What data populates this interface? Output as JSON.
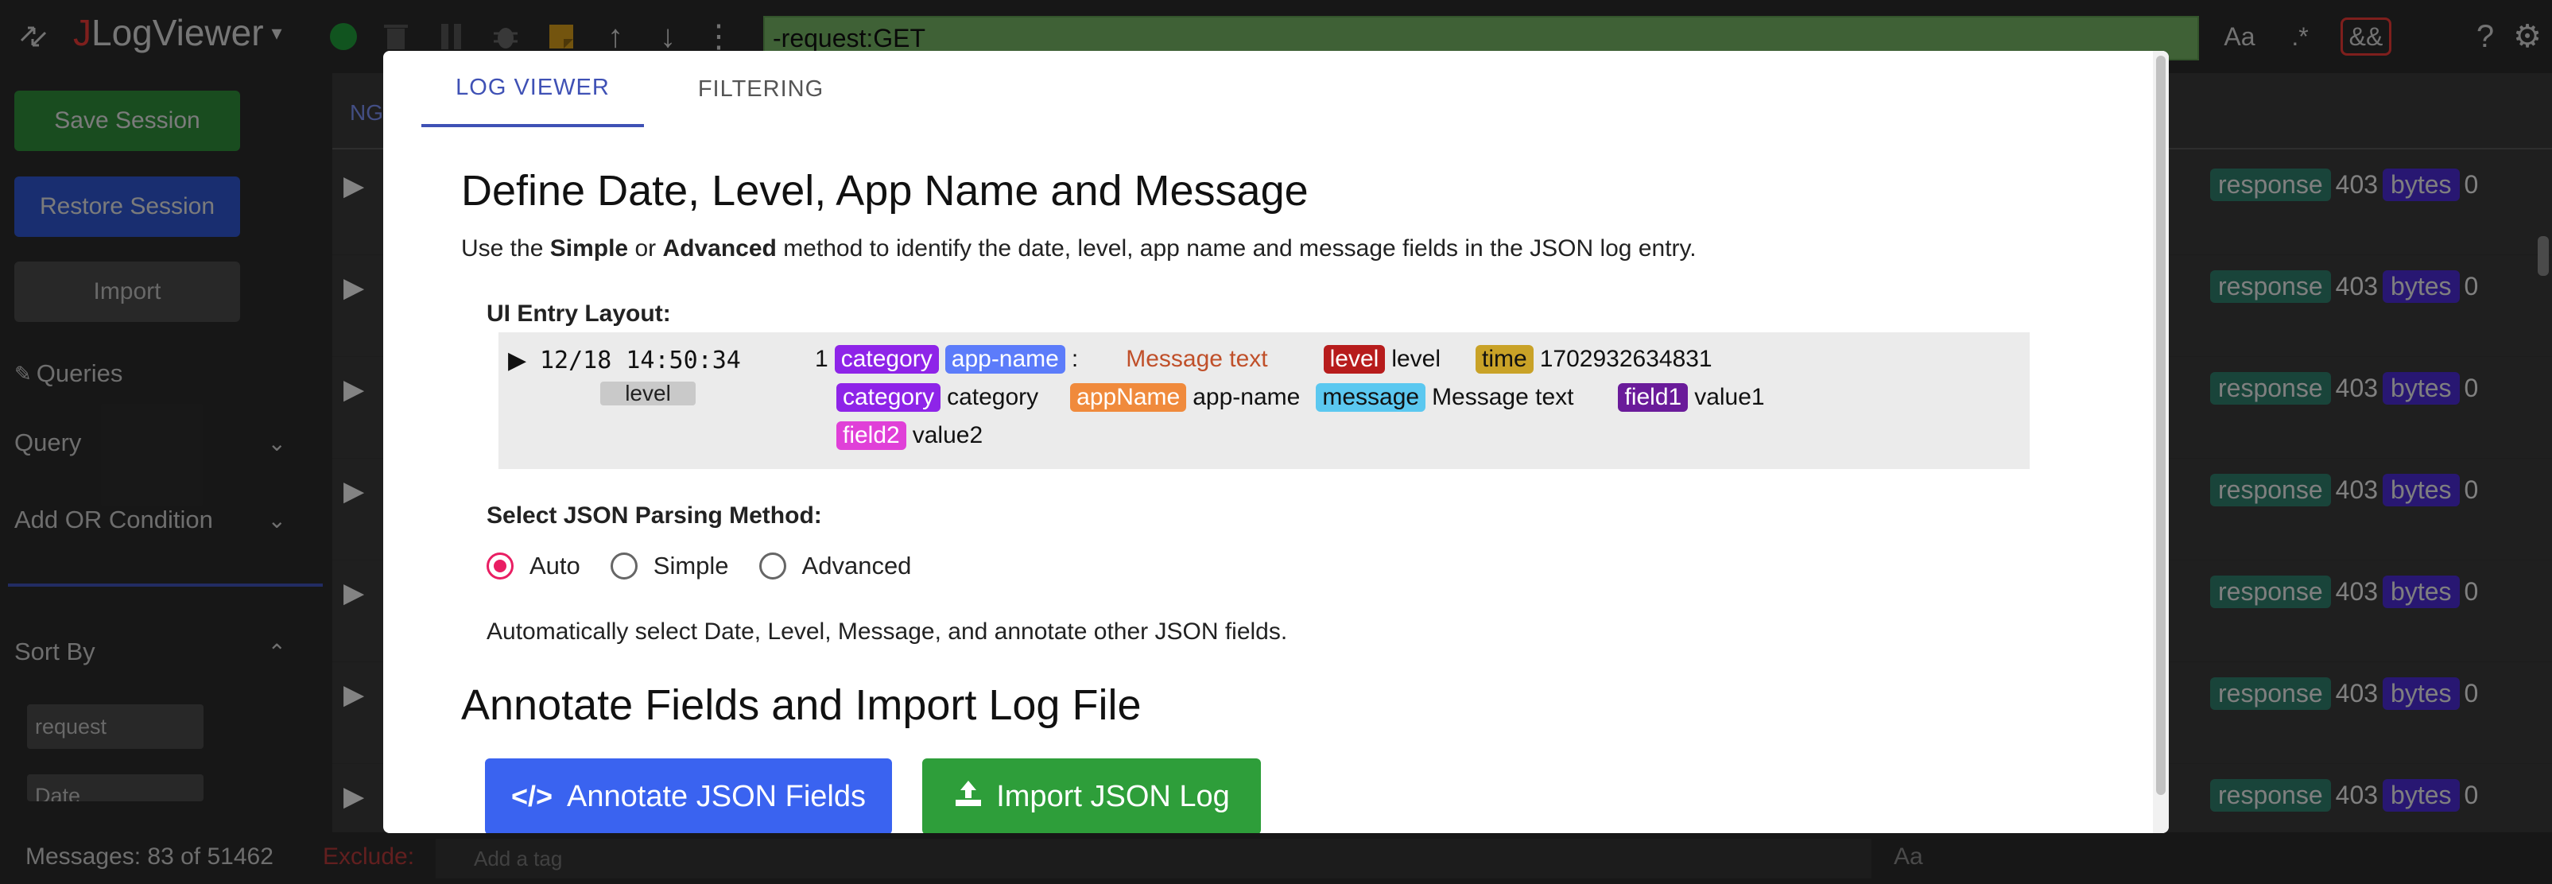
{
  "app": {
    "brand_j": "J",
    "brand_rest": "LogViewer"
  },
  "search": {
    "query": "-request:GET"
  },
  "toolbar_right": {
    "case_label": "Aa",
    "regex_label": ".*",
    "and_label": "&&"
  },
  "sidebar": {
    "save_label": "Save Session",
    "restore_label": "Restore Session",
    "import_label": "Import",
    "queries_label": "Queries",
    "query_label": "Query",
    "or_label": "Add OR Condition",
    "sort_label": "Sort By",
    "sort_fields": [
      "request",
      "Date"
    ]
  },
  "log": {
    "partial_tab": "NG",
    "rows": [
      {
        "resp_tag": "response",
        "resp_val": "403",
        "bytes_tag": "bytes",
        "bytes_val": "0"
      },
      {
        "resp_tag": "response",
        "resp_val": "403",
        "bytes_tag": "bytes",
        "bytes_val": "0"
      },
      {
        "resp_tag": "response",
        "resp_val": "403",
        "bytes_tag": "bytes",
        "bytes_val": "0"
      },
      {
        "resp_tag": "response",
        "resp_val": "403",
        "bytes_tag": "bytes",
        "bytes_val": "0"
      },
      {
        "resp_tag": "response",
        "resp_val": "403",
        "bytes_tag": "bytes",
        "bytes_val": "0"
      },
      {
        "resp_tag": "response",
        "resp_val": "403",
        "bytes_tag": "bytes",
        "bytes_val": "0"
      },
      {
        "resp_tag": "response",
        "resp_val": "403",
        "bytes_tag": "bytes",
        "bytes_val": "0"
      }
    ]
  },
  "footer": {
    "messages": "Messages: 83 of 51462",
    "exclude_label": "Exclude:",
    "tag_placeholder": "Add a tag",
    "case_label": "Aa"
  },
  "modal": {
    "tabs": [
      "LOG VIEWER",
      "FILTERING"
    ],
    "heading1": "Define Date, Level, App Name and Message",
    "desc_pre": "Use the ",
    "desc_simple": "Simple",
    "desc_mid": " or ",
    "desc_advanced": "Advanced",
    "desc_post": " method to identify the date, level, app name and message fields in the JSON log entry.",
    "layout_label": "UI Entry Layout:",
    "entry": {
      "datetime": "12/18 14:50:34",
      "level_badge": "level",
      "count": "1",
      "cat_badge": "category",
      "app_badge": "app-name",
      "colon": ":",
      "message_text": "Message text",
      "lvl_badge": "level",
      "lvl_val": "level",
      "time_badge": "time",
      "time_val": "1702932634831",
      "cat2_badge": "category",
      "cat2_val": "category",
      "appName_badge": "appName",
      "appName_val": "app-name",
      "msg_badge": "message",
      "msg_val": "Message text",
      "f1_badge": "field1",
      "f1_val": "value1",
      "f2_badge": "field2",
      "f2_val": "value2"
    },
    "parsing_label": "Select JSON Parsing Method:",
    "options": [
      "Auto",
      "Simple",
      "Advanced"
    ],
    "selected_option": "Auto",
    "auto_desc": "Automatically select Date, Level, Message, and annotate other JSON fields.",
    "heading2": "Annotate Fields and Import Log File",
    "annotate_btn": "Annotate JSON Fields",
    "import_btn": "Import JSON Log"
  },
  "colors": {
    "accent": "#3f51b5",
    "radio": "#e91e63",
    "annotate": "#3a63f0",
    "import": "#2e9e3a",
    "search_bg": "#73b163"
  }
}
